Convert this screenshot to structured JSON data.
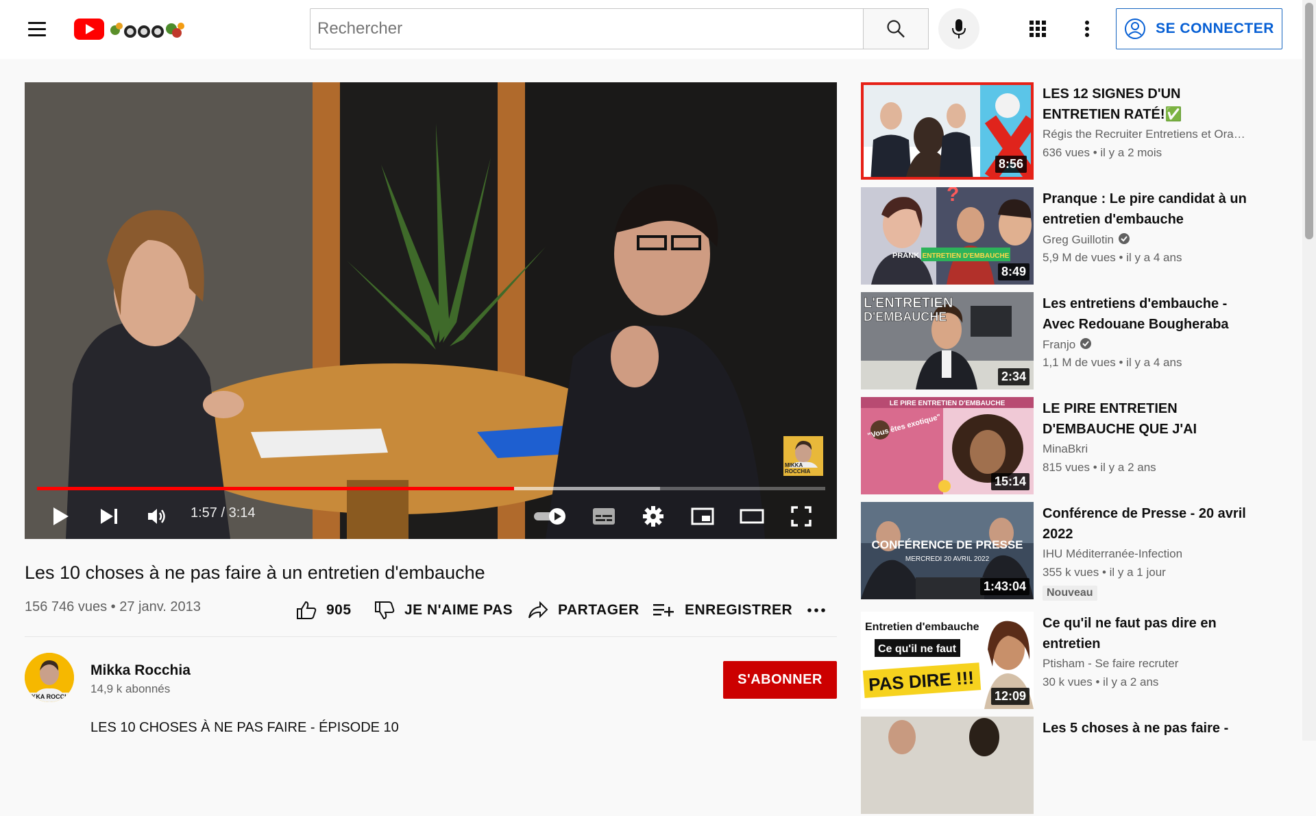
{
  "header": {
    "search_placeholder": "Rechercher",
    "signin_label": "SE CONNECTER"
  },
  "player": {
    "time": "1:57 / 3:14",
    "progress_played": 0.605,
    "progress_buffered": 0.79,
    "watermark": "MIKKA ROCCHIA"
  },
  "video": {
    "title": "Les 10 choses à ne pas faire à un entretien d'embauche",
    "meta": "156 746 vues • 27 janv. 2013",
    "likes": "905",
    "dislike_label": "JE N'AIME PAS",
    "share_label": "PARTAGER",
    "save_label": "ENREGISTRER"
  },
  "channel": {
    "name": "Mikka Rocchia",
    "subscribers": "14,9 k abonnés",
    "subscribe_label": "S'ABONNER",
    "avatar_text": "IKKA ROCCH",
    "description_first_line": "LES 10 CHOSES À NE PAS FAIRE - ÉPISODE 10"
  },
  "recommendations": [
    {
      "title": "LES 12 SIGNES D'UN ENTRETIEN RATÉ!✅",
      "channel": "Régis the Recruiter Entretiens et Ora…",
      "meta": "636 vues • il y a 2 mois",
      "duration": "8:56",
      "verified": false
    },
    {
      "title": "Pranque : Le pire candidat à un entretien d'embauche",
      "channel": "Greg Guillotin",
      "meta": "5,9 M de vues • il y a 4 ans",
      "duration": "8:49",
      "verified": true,
      "thumb_text": [
        "PRANK",
        "ENTRETIEN D'EMBAUCHE"
      ]
    },
    {
      "title": "Les entretiens d'embauche - Avec Redouane Bougheraba",
      "channel": "Franjo",
      "meta": "1,1 M de vues • il y a 4 ans",
      "duration": "2:34",
      "verified": true,
      "thumb_text": [
        "L'ENTRETIEN",
        "D'EMBAUCHE"
      ]
    },
    {
      "title": "LE PIRE ENTRETIEN D'EMBAUCHE QUE J'AI PASSE…",
      "channel": "MinaBkri",
      "meta": "815 vues • il y a 2 ans",
      "duration": "15:14",
      "verified": false,
      "thumb_text": [
        "LE PIRE ENTRETIEN D'EMBAUCHE",
        "\"Vous êtes exotique\""
      ]
    },
    {
      "title": "Conférence de Presse - 20 avril 2022",
      "channel": "IHU Méditerranée-Infection",
      "meta": "355 k vues • il y a 1 jour",
      "duration": "1:43:04",
      "verified": false,
      "badge": "Nouveau",
      "thumb_text": [
        "CONFÉRENCE DE PRESSE",
        "MERCREDI 20 AVRIL 2022"
      ]
    },
    {
      "title": "Ce qu'il ne faut pas dire en entretien",
      "channel": "Ptisham - Se faire recruter",
      "meta": "30 k vues • il y a 2 ans",
      "duration": "12:09",
      "verified": false,
      "thumb_text": [
        "Entretien d'embauche",
        "Ce qu'il ne faut",
        "PAS DIRE !!!"
      ]
    },
    {
      "title": "Les 5 choses à ne pas faire -",
      "channel": "",
      "meta": "",
      "duration": "",
      "verified": false
    }
  ]
}
